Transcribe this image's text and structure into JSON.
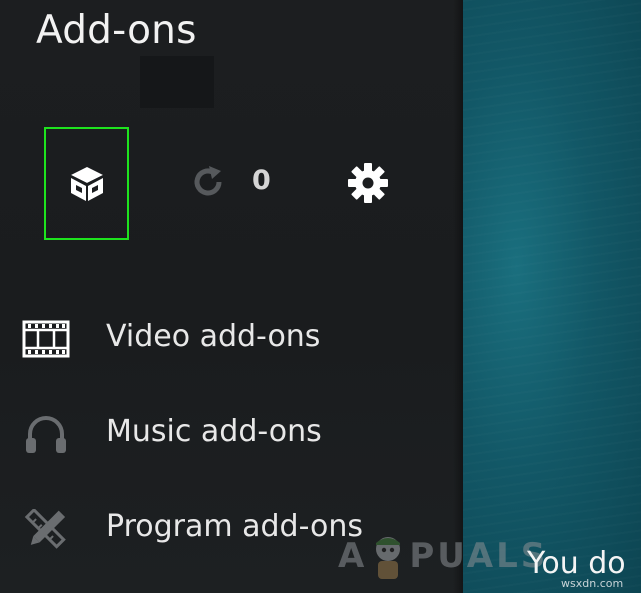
{
  "header": {
    "title": "Add-ons"
  },
  "toolbar": {
    "install_icon": "open-box-icon",
    "update_icon": "refresh-icon",
    "update_count": "0",
    "settings_icon": "gear-icon",
    "highlight_color": "#1ee31e"
  },
  "menu": {
    "items": [
      {
        "label": "Video add-ons",
        "icon": "film-strip-icon"
      },
      {
        "label": "Music add-ons",
        "icon": "headphones-icon"
      },
      {
        "label": "Program add-ons",
        "icon": "pencil-ruler-icon"
      }
    ]
  },
  "backdrop": {
    "text": "You do"
  },
  "watermark": {
    "left_text": "A",
    "right_text": "PUALS",
    "site": "wsxdn.com"
  }
}
